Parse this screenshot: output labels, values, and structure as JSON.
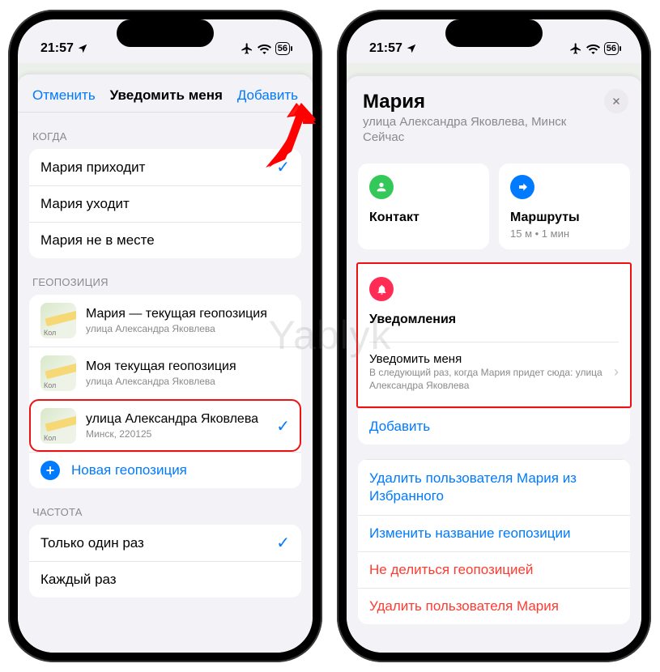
{
  "watermark": "Yablyk",
  "status": {
    "time": "21:57",
    "battery": "56"
  },
  "left": {
    "nav": {
      "cancel": "Отменить",
      "title": "Уведомить меня",
      "add": "Добавить"
    },
    "sec_when": "КОГДА",
    "when": [
      {
        "label": "Мария приходит",
        "checked": true
      },
      {
        "label": "Мария уходит",
        "checked": false
      },
      {
        "label": "Мария не в месте",
        "checked": false
      }
    ],
    "sec_loc": "ГЕОПОЗИЦИЯ",
    "loc": [
      {
        "title": "Мария — текущая геопозиция",
        "sub": "улица Александра Яковлева",
        "mini": "Кол"
      },
      {
        "title": "Моя текущая геопозиция",
        "sub": "улица Александра Яковлева",
        "mini": "Кол"
      },
      {
        "title": "улица Александра Яковлева",
        "sub": "Минск, 220125",
        "mini": "Кол",
        "checked": true,
        "hl": true
      }
    ],
    "new_loc": "Новая геопозиция",
    "sec_freq": "ЧАСТОТА",
    "freq": [
      {
        "label": "Только один раз",
        "checked": true
      },
      {
        "label": "Каждый раз",
        "checked": false
      }
    ]
  },
  "right": {
    "name": "Мария",
    "addr": "улица Александра Яковлева, Минск",
    "now": "Сейчас",
    "tiles": {
      "contact": "Контакт",
      "routes": "Маршруты",
      "routes_meta": "15 м • 1 мин"
    },
    "notif": {
      "header": "Уведомления",
      "item_title": "Уведомить меня",
      "item_sub": "В следующий раз, когда Мария придет сюда: улица Александра Яковлева",
      "add": "Добавить"
    },
    "links": {
      "remove_fav": "Удалить пользователя Мария из Избранного",
      "rename": "Изменить название геопозиции",
      "stop_share": "Не делиться геопозицией",
      "remove_user": "Удалить пользователя Мария"
    }
  }
}
